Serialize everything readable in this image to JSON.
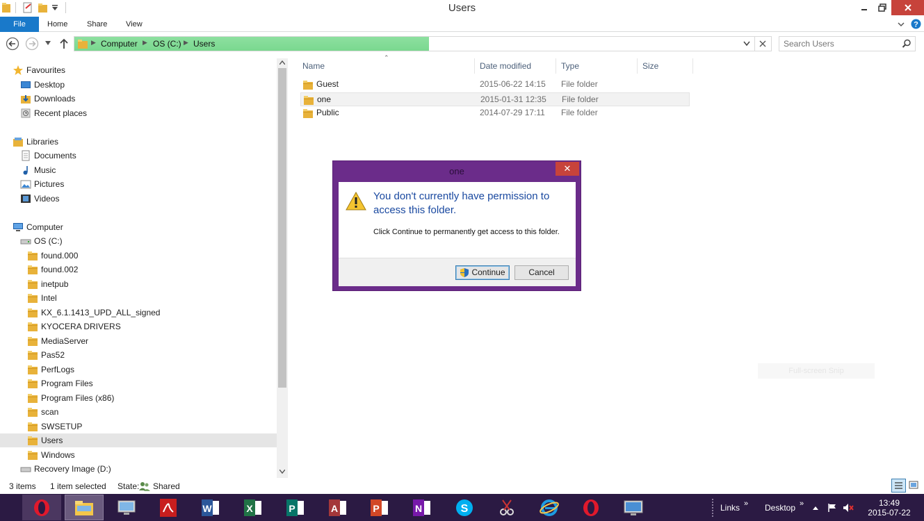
{
  "window": {
    "title": "Users"
  },
  "ribbon": {
    "tabs": [
      "File",
      "Home",
      "Share",
      "View"
    ]
  },
  "address": {
    "crumbs": [
      "Computer",
      "OS (C:)",
      "Users"
    ],
    "search_placeholder": "Search Users"
  },
  "nav": {
    "favourites": {
      "label": "Favourites",
      "items": [
        "Desktop",
        "Downloads",
        "Recent places"
      ]
    },
    "libraries": {
      "label": "Libraries",
      "items": [
        "Documents",
        "Music",
        "Pictures",
        "Videos"
      ]
    },
    "computer": {
      "label": "Computer",
      "drive_c": "OS (C:)",
      "folders": [
        "found.000",
        "found.002",
        "inetpub",
        "Intel",
        "KX_6.1.1413_UPD_ALL_signed",
        "KYOCERA DRIVERS",
        "MediaServer",
        "Pas52",
        "PerfLogs",
        "Program Files",
        "Program Files (x86)",
        "scan",
        "SWSETUP",
        "Users",
        "Windows"
      ],
      "selected_folder": "Users",
      "drive_d": "Recovery Image (D:)"
    }
  },
  "filelist": {
    "columns": [
      "Name",
      "Date modified",
      "Type",
      "Size"
    ],
    "rows": [
      {
        "name": "Guest",
        "date": "2015-06-22 14:15",
        "type": "File folder",
        "size": ""
      },
      {
        "name": "one",
        "date": "2015-01-31 12:35",
        "type": "File folder",
        "size": ""
      },
      {
        "name": "Public",
        "date": "2014-07-29 17:11",
        "type": "File folder",
        "size": ""
      }
    ],
    "hot_row": "one"
  },
  "dialog": {
    "title": "one",
    "heading": "You don't currently have permission to access this folder.",
    "body": "Click Continue to permanently get access to this folder.",
    "continue_label": "Continue",
    "cancel_label": "Cancel",
    "close_glyph": "✕"
  },
  "snip_hint": "Full-screen Snip",
  "status": {
    "items": "3 items",
    "selected": "1 item selected",
    "state_label": "State:",
    "state_value": "Shared"
  },
  "taskbar": {
    "apps": [
      "opera-icon",
      "file-explorer-icon",
      "control-panel-icon",
      "acrobat-icon",
      "word-icon",
      "excel-icon",
      "publisher-icon",
      "access-icon",
      "powerpoint-icon",
      "onenote-icon",
      "skype-icon",
      "snipping-tool-icon",
      "internet-explorer-icon",
      "opera-icon",
      "remote-desktop-icon"
    ],
    "links_label": "Links",
    "desktop_label": "Desktop",
    "time": "13:49",
    "date": "2015-07-22"
  },
  "colors": {
    "file_tab": "#1979ca",
    "address_fill": "#7ad88f",
    "dialog_frame": "#6b2c8a",
    "dialog_close": "#c7433b",
    "dialog_heading": "#1a49a0",
    "taskbar": "#2b1a43"
  }
}
